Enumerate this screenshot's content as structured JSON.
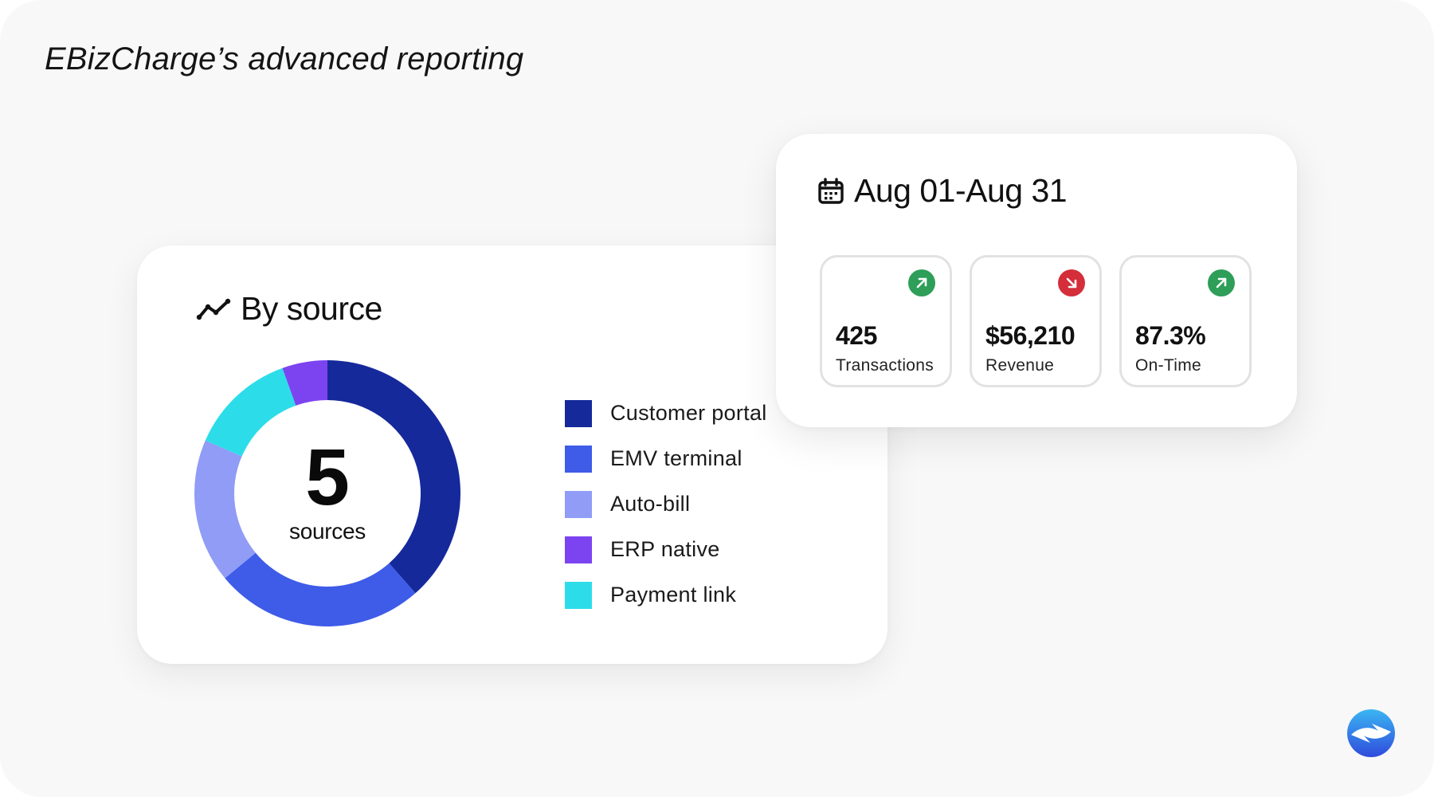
{
  "page_title": "EBizCharge’s advanced reporting",
  "source_card": {
    "title": "By source",
    "icon": "trend-line-icon",
    "center_number": "5",
    "center_unit": "sources"
  },
  "stats_card": {
    "date_range": "Aug 01-Aug 31",
    "icon": "calendar-icon",
    "stats": [
      {
        "value": "425",
        "label": "Transactions",
        "trend": "up",
        "badge_color": "#2e9e58"
      },
      {
        "value": "$56,210",
        "label": "Revenue",
        "trend": "down",
        "badge_color": "#d42e3a"
      },
      {
        "value": "87.3%",
        "label": "On-Time",
        "trend": "up",
        "badge_color": "#2e9e58"
      }
    ]
  },
  "chart_data": {
    "type": "pie",
    "title": "By source",
    "donut": true,
    "center_text": "5 sources",
    "legend_position": "right",
    "series": [
      {
        "name": "Customer portal",
        "value": 38.5,
        "color": "#16299b"
      },
      {
        "name": "EMV terminal",
        "value": 25.5,
        "color": "#3e5ce8"
      },
      {
        "name": "Auto-bill",
        "value": 17.5,
        "color": "#909cf6"
      },
      {
        "name": "Payment link",
        "value": 13.0,
        "color": "#2cdde9"
      },
      {
        "name": "ERP native",
        "value": 5.5,
        "color": "#7c44f1"
      }
    ],
    "legend_order": [
      "Customer portal",
      "EMV terminal",
      "Auto-bill",
      "ERP native",
      "Payment link"
    ]
  },
  "brand": {
    "logo_icon": "ebizcharge-logo-icon",
    "primary_color": "#2f4bdc",
    "light_color": "#3bb5f2"
  }
}
